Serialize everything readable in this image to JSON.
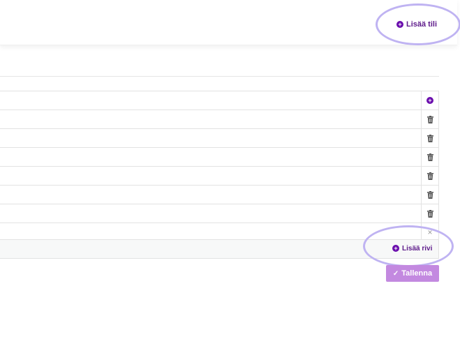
{
  "header": {
    "add_account_label": "Lisää tili"
  },
  "table": {
    "row_actions": [
      "add",
      "delete",
      "delete",
      "delete",
      "delete",
      "delete",
      "delete",
      "close"
    ]
  },
  "footer": {
    "add_row_label": "Lisää rivi",
    "save_label": "Tallenna"
  },
  "icons": {
    "plus": "+",
    "close": "×",
    "check": "✓"
  },
  "colors": {
    "accent": "#6a0dad",
    "accent_text": "#5d1a8a",
    "save_button": "#c389e0",
    "highlight_ring": "#bfb3f2"
  }
}
